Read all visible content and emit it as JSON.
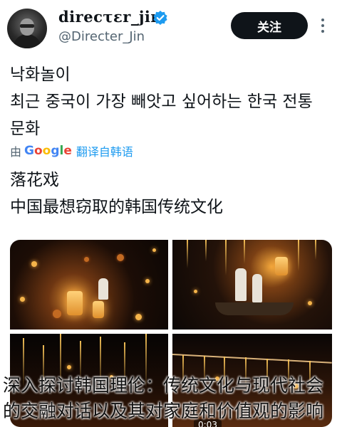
{
  "user": {
    "display_name": "direcτεr_jin",
    "handle": "@Directer_Jin",
    "verified": true
  },
  "header": {
    "follow_label": "关注"
  },
  "tweet": {
    "line1": "낙화놀이",
    "line2": "최근 중국이 가장 빼앗고 싶어하는 한국 전통",
    "line3": "문화"
  },
  "translation": {
    "by_label": "由",
    "provider_letters": [
      "G",
      "o",
      "o",
      "g",
      "l",
      "e"
    ],
    "link_label": "翻译自韩语",
    "line1": "落花戏",
    "line2": "中国最想窃取的韩国传统文化"
  },
  "media": {
    "video_time": "0:03"
  },
  "overlay": {
    "line1": "深入探讨韩国理伦：传统文化与现代社会",
    "line2": "的交融对话以及其对家庭和价值观的影响"
  },
  "colors": {
    "follow_bg": "#0f1419",
    "verified": "#1d9bf0",
    "link": "#1d9bf0",
    "muted": "#536471"
  }
}
